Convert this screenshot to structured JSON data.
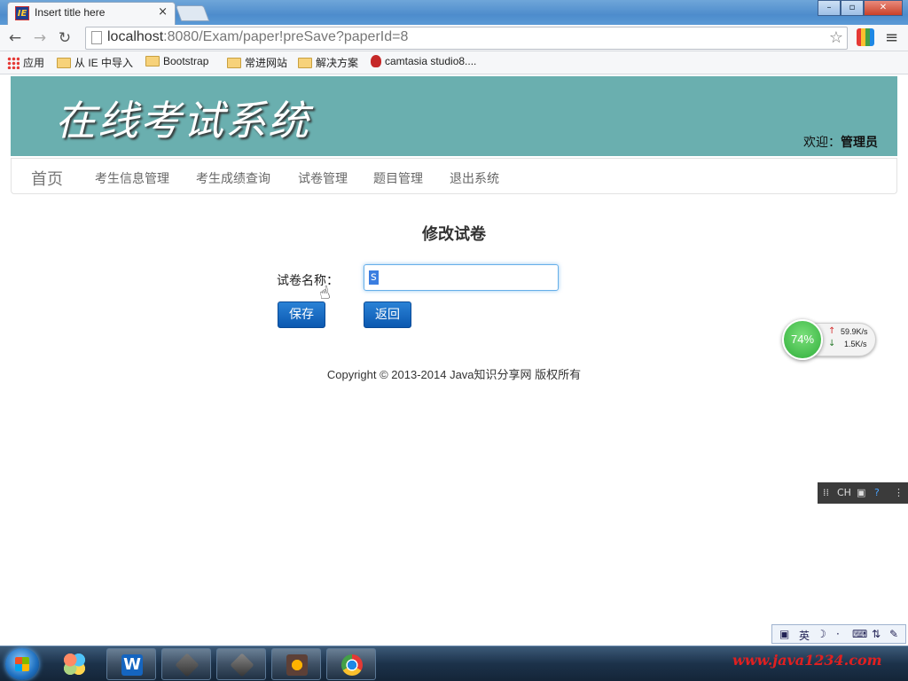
{
  "browser": {
    "tab_title": "Insert title here",
    "tab_close": "×",
    "url_host": "localhost",
    "url_path": ":8080/Exam/paper!preSave?paperId=8",
    "window_buttons": [
      "–",
      "▫",
      "✕"
    ]
  },
  "bookmarks": [
    {
      "label": "应用",
      "icon": "apps-icon"
    },
    {
      "label": "从 IE 中导入",
      "icon": "folder-icon"
    },
    {
      "label": "Bootstrap",
      "icon": "folder-icon"
    },
    {
      "label": "常进网站",
      "icon": "folder-icon"
    },
    {
      "label": "解决方案",
      "icon": "folder-icon"
    },
    {
      "label": "camtasia studio8....",
      "icon": "camtasia-icon"
    }
  ],
  "header": {
    "title": "在线考试系统",
    "welcome_prefix": "欢迎：",
    "welcome_user": "管理员"
  },
  "nav": {
    "brand": "首页",
    "links": [
      "考生信息管理",
      "考生成绩查询",
      "试卷管理",
      "题目管理",
      "退出系统"
    ]
  },
  "form": {
    "title": "修改试卷",
    "name_label": "试卷名称：",
    "name_value": "s",
    "save_label": "保存",
    "back_label": "返回"
  },
  "footer": {
    "copyright": "Copyright © 2013-2014 Java知识分享网 版权所有"
  },
  "netmonitor": {
    "percent": "74%",
    "upload": "59.9K/s",
    "download": "1.5K/s"
  },
  "ime": {
    "lang_top": "CH",
    "lang_bottom": "英"
  },
  "watermark": "www.java1234.com",
  "colors": {
    "banner": "#6aafaf",
    "button": "#0b58b0",
    "net_green": "#2fae3a"
  }
}
